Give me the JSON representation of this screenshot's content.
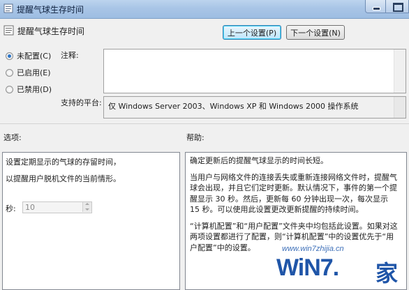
{
  "window": {
    "title": "提醒气球生存时间"
  },
  "header": {
    "title": "提醒气球生存时间"
  },
  "nav": {
    "prev_label": "上一个设置(P)",
    "next_label": "下一个设置(N)"
  },
  "state": {
    "options": [
      {
        "label": "未配置(C)",
        "checked": true
      },
      {
        "label": "已启用(E)",
        "checked": false
      },
      {
        "label": "已禁用(D)",
        "checked": false
      }
    ]
  },
  "comment": {
    "label": "注释:",
    "value": ""
  },
  "supported": {
    "label": "支持的平台:",
    "value": "仅 Windows Server 2003、Windows XP 和 Windows 2000 操作系统"
  },
  "sections": {
    "options_label": "选项:",
    "help_label": "帮助:"
  },
  "options_panel": {
    "line1": "设置定期显示的气球的存留时间，",
    "line2": "以提醒用户脱机文件的当前情形。",
    "seconds_label": "秒:",
    "seconds_value": "10"
  },
  "help": {
    "paragraphs": [
      "确定更新后的提醒气球显示的时间长短。",
      "当用户与网络文件的连接丢失或重新连接网络文件时，提醒气球会出现，并且它们定时更新。默认情况下，事件的第一个提醒显示 30 秒。然后，更新每 60 分钟出现一次，每次显示 15 秒。可以使用此设置更改更新提醒的持续时间。",
      "“计算机配置”和“用户配置”文件夹中均包括此设置。如果对这两项设置都进行了配置，则“计算机配置”中的设置优先于“用户配置”中的设置。"
    ]
  },
  "watermark": {
    "site": "www.win7zhijia.cn",
    "brand": "WiN7.",
    "brand_cn": "家"
  }
}
